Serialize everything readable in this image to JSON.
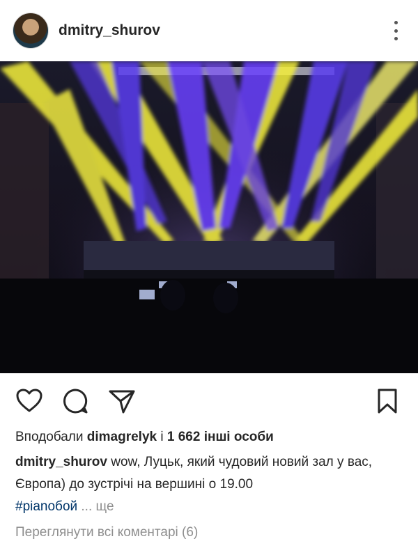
{
  "header": {
    "username": "dmitry_shurov",
    "icons": {
      "avatar": "profile-avatar",
      "more": "more-vertical-icon"
    }
  },
  "actions": {
    "icons": [
      "heart-icon",
      "comment-icon",
      "share-icon",
      "bookmark-icon"
    ]
  },
  "likes": {
    "prefix": "Вподобали",
    "liker": "dimagrelyk",
    "joiner": "і",
    "others": "1 662 інші особи"
  },
  "caption": {
    "author": "dmitry_shurov",
    "text": "wow, Луцьк, який чудовий новий зал у вас, Європа) до зустрічі на вершині о 19.00",
    "hashtag": "#pianoбой",
    "more": "... ще"
  },
  "comments": {
    "view_all": "Переглянути всі коментарі (6)"
  },
  "colors": {
    "text": "#262626",
    "muted": "#8e8e8e",
    "hashtag": "#003569",
    "beam_yellow": "#f5f03a",
    "beam_blue": "#5a3cf0"
  }
}
